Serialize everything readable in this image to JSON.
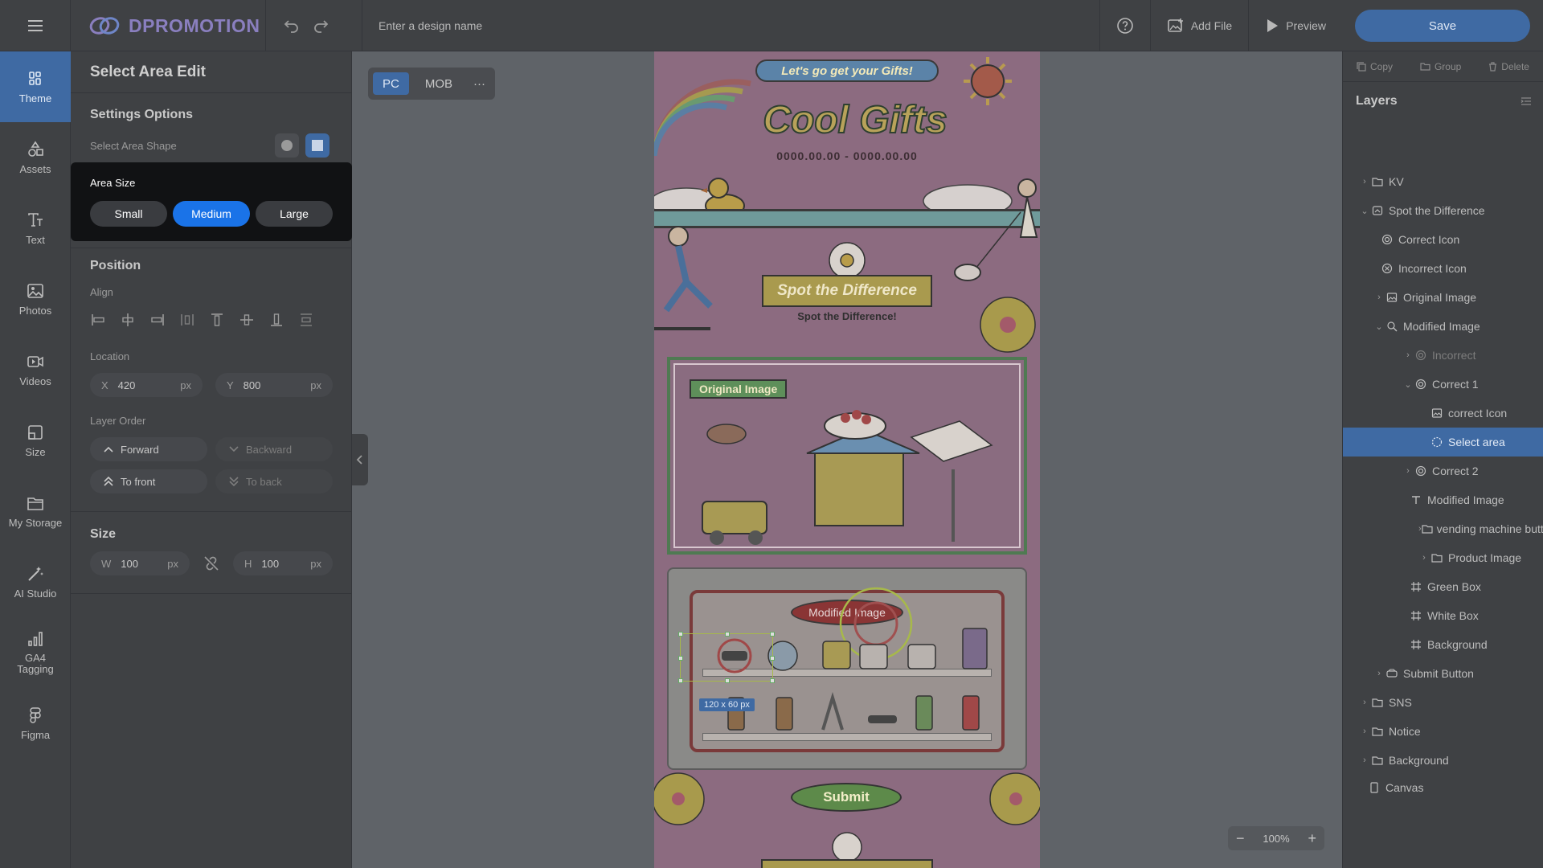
{
  "app": {
    "logo_text": "DPROMOTION",
    "design_name_placeholder": "Enter a design name",
    "help_icon": "help-icon",
    "add_file_label": "Add File",
    "preview_label": "Preview",
    "save_label": "Save"
  },
  "rail": [
    {
      "label": "Theme",
      "icon": "theme-icon"
    },
    {
      "label": "Assets",
      "icon": "assets-icon"
    },
    {
      "label": "Text",
      "icon": "text-icon"
    },
    {
      "label": "Photos",
      "icon": "photos-icon"
    },
    {
      "label": "Videos",
      "icon": "videos-icon"
    },
    {
      "label": "Size",
      "icon": "size-icon"
    },
    {
      "label": "My Storage",
      "icon": "folder-icon"
    },
    {
      "label": "AI Studio",
      "icon": "ai-studio-icon"
    },
    {
      "label": "GA4\nTagging",
      "icon": "ga4-icon"
    },
    {
      "label": "Figma",
      "icon": "figma-icon"
    }
  ],
  "panel": {
    "title": "Select Area Edit",
    "settings_title": "Settings Options",
    "shape_label": "Select Area Shape",
    "area_size_label": "Area Size",
    "area_sizes": [
      "Small",
      "Medium",
      "Large"
    ],
    "area_size_selected": "Medium",
    "position_title": "Position",
    "align_label": "Align",
    "location_label": "Location",
    "x_label": "X",
    "x_value": "420",
    "y_label": "Y",
    "y_value": "800",
    "unit": "px",
    "layer_order_label": "Layer Order",
    "forward": "Forward",
    "backward": "Backward",
    "to_front": "To front",
    "to_back": "To back",
    "size_title": "Size",
    "w_label": "W",
    "w_value": "100",
    "h_label": "H",
    "h_value": "100"
  },
  "device": {
    "pc": "PC",
    "mob": "MOB",
    "more": "···"
  },
  "canvas": {
    "pill": "Let's go get your Gifts!",
    "title": "Cool Gifts",
    "date": "0000.00.00 - 0000.00.00",
    "banner": "Spot the Difference",
    "banner_sub": "Spot the Difference!",
    "original_label": "Original Image",
    "modified_label": "Modified Image",
    "size_tag": "120 x 60 px",
    "submit": "Submit"
  },
  "zoom": {
    "value": "100%",
    "minus": "−",
    "plus": "+"
  },
  "right": {
    "copy": "Copy",
    "group": "Group",
    "delete": "Delete",
    "layers_title": "Layers",
    "layers": [
      {
        "label": "KV",
        "caret": "›",
        "icon": "folder-icon"
      },
      {
        "label": "Spot the Difference",
        "caret": "⌄",
        "icon": "component-icon"
      },
      {
        "label": "Correct Icon",
        "caret": "",
        "icon": "target-icon"
      },
      {
        "label": "Incorrect Icon",
        "caret": "",
        "icon": "x-circle-icon"
      },
      {
        "label": "Original Image",
        "caret": "›",
        "icon": "image-icon"
      },
      {
        "label": "Modified Image",
        "caret": "⌄",
        "icon": "search-icon"
      },
      {
        "label": "Incorrect",
        "caret": "›",
        "icon": "target-icon",
        "dim": true
      },
      {
        "label": "Correct 1",
        "caret": "⌄",
        "icon": "target-icon"
      },
      {
        "label": "correct Icon",
        "caret": "",
        "icon": "image-icon"
      },
      {
        "label": "Select area",
        "caret": "",
        "icon": "select-area-icon",
        "selected": true
      },
      {
        "label": "Correct 2",
        "caret": "›",
        "icon": "target-icon"
      },
      {
        "label": "Modified Image",
        "caret": "",
        "icon": "text-icon"
      },
      {
        "label": "vending machine butto",
        "caret": "›",
        "icon": "folder-icon"
      },
      {
        "label": "Product Image",
        "caret": "›",
        "icon": "folder-icon"
      },
      {
        "label": "Green Box",
        "caret": "",
        "icon": "frame-icon"
      },
      {
        "label": "White Box",
        "caret": "",
        "icon": "frame-icon"
      },
      {
        "label": "Background",
        "caret": "",
        "icon": "frame-icon"
      },
      {
        "label": "Submit Button",
        "caret": "›",
        "icon": "button-icon"
      },
      {
        "label": "SNS",
        "caret": "›",
        "icon": "folder-icon"
      },
      {
        "label": "Notice",
        "caret": "›",
        "icon": "folder-icon"
      },
      {
        "label": "Background",
        "caret": "›",
        "icon": "folder-icon"
      },
      {
        "label": "Canvas",
        "caret": "",
        "icon": "canvas-icon"
      }
    ]
  },
  "colors": {
    "accent": "#3f6aa3",
    "medium_selected": "#1a73e8",
    "popup_bg": "#111214"
  }
}
